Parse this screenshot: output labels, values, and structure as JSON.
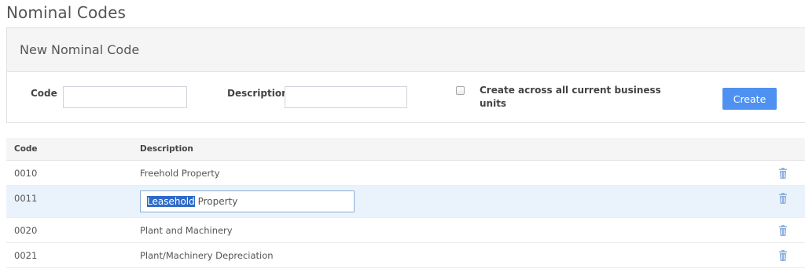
{
  "page": {
    "title": "Nominal Codes"
  },
  "new_code_panel": {
    "heading": "New Nominal Code",
    "code_label": "Code",
    "code_value": "",
    "description_label": "Description",
    "description_value": "",
    "checkbox_checked": false,
    "checkbox_label": "Create across all current business units",
    "create_button": "Create"
  },
  "table": {
    "columns": [
      "Code",
      "Description"
    ],
    "rows": [
      {
        "code": "0010",
        "description": "Freehold Property",
        "editing": false
      },
      {
        "code": "0011",
        "description": "Leasehold Property",
        "editing": true,
        "selected_text": "Leasehold",
        "rest_text": " Property"
      },
      {
        "code": "0020",
        "description": "Plant and Machinery",
        "editing": false
      },
      {
        "code": "0021",
        "description": "Plant/Machinery Depreciation",
        "editing": false
      }
    ],
    "delete_icon": "trash-icon"
  },
  "colors": {
    "accent": "#4f91f1",
    "selection": "#2e6ac9",
    "editing_row_bg": "#eaf3fb",
    "trash_icon": "#8fb0de"
  }
}
